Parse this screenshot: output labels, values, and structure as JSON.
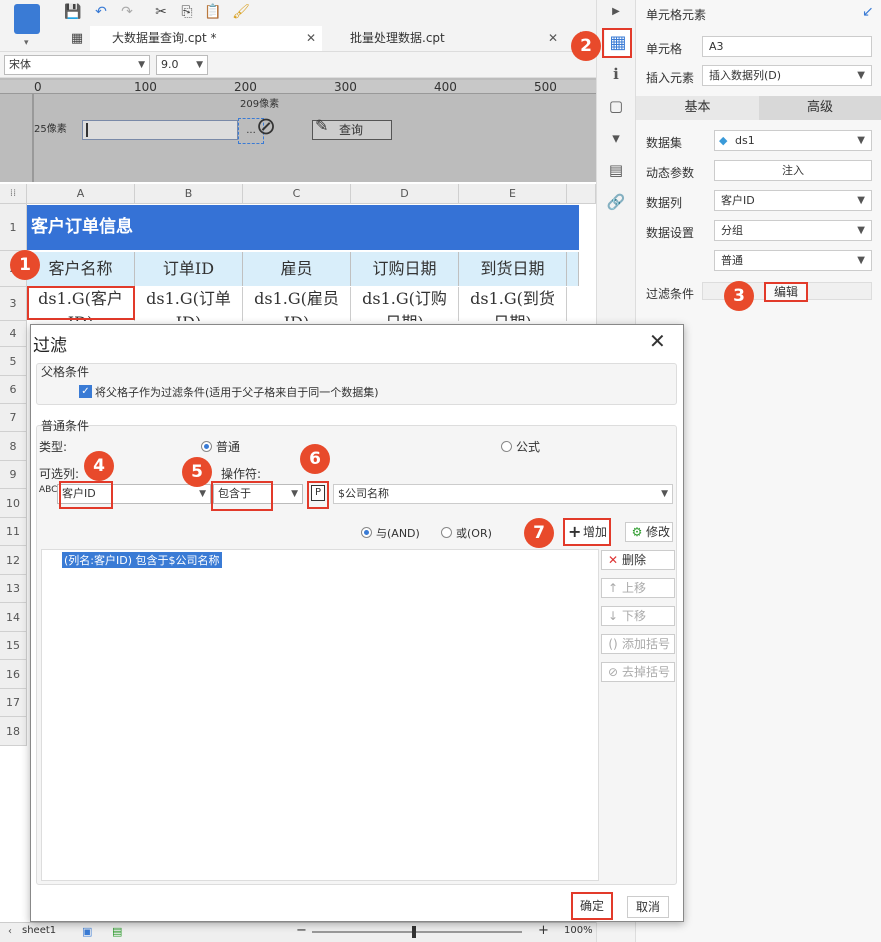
{
  "toolbar": {
    "tab1": "大数据量查询.cpt *",
    "tab2": "批量处理数据.cpt",
    "font": "宋体",
    "size": "9.0"
  },
  "ruler": {
    "marks": [
      "0",
      "100",
      "200",
      "300",
      "400",
      "500"
    ]
  },
  "param_pane": {
    "label_209": "209像素",
    "label_25": "25像素",
    "query_button": "查询",
    "ellipsis": "..."
  },
  "grid": {
    "columns": [
      "A",
      "B",
      "C",
      "D",
      "E"
    ],
    "rows": [
      "1",
      "2",
      "3",
      "4",
      "5",
      "6",
      "7",
      "8",
      "9",
      "10",
      "11",
      "12",
      "13",
      "14",
      "15",
      "16",
      "17",
      "18"
    ],
    "title": "客户订单信息",
    "headers": [
      "客户名称",
      "订单ID",
      "雇员",
      "订购日期",
      "到货日期"
    ],
    "cells": [
      "ds1.G(客户",
      "ds1.G(订单",
      "ds1.G(雇员",
      "ds1.G(订购",
      "ds1.G(到货"
    ],
    "cells2": [
      "ID)",
      "ID)",
      "ID)",
      "日期)",
      "日期)"
    ]
  },
  "panel": {
    "title": "单元格元素",
    "cell_label": "单元格",
    "cell_value": "A3",
    "insert_label": "插入元素",
    "insert_value": "插入数据列(D)",
    "tab_basic": "基本",
    "tab_adv": "高级",
    "dataset_label": "数据集",
    "dataset_value": "ds1",
    "param_label": "动态参数",
    "param_button": "注入",
    "column_label": "数据列",
    "column_value": "客户ID",
    "setting_label": "数据设置",
    "setting_value": "分组",
    "setting_value2": "普通",
    "filter_label": "过滤条件",
    "filter_button": "编辑"
  },
  "dialog": {
    "title": "过滤",
    "parent_group": "父格条件",
    "parent_check": "将父格子作为过滤条件(适用于父子格来自于同一个数据集)",
    "normal_group": "普通条件",
    "type_label": "类型:",
    "type_normal": "普通",
    "type_formula": "公式",
    "col_label": "可选列:",
    "col_value": "客户ID",
    "op_label": "操作符:",
    "op_value": "包含于",
    "param_value": "$公司名称",
    "and_label": "与(AND)",
    "or_label": "或(OR)",
    "add": "增加",
    "edit": "修改",
    "delete": "删除",
    "up": "上移",
    "down": "下移",
    "add_paren": "添加括号",
    "remove_paren": "去掉括号",
    "condition": "(列名:客户ID) 包含于$公司名称",
    "ok": "确定",
    "cancel": "取消"
  },
  "badges": [
    "1",
    "2",
    "3",
    "4",
    "5",
    "6",
    "7"
  ],
  "status": {
    "sheet": "sheet1",
    "zoom": "100%"
  }
}
